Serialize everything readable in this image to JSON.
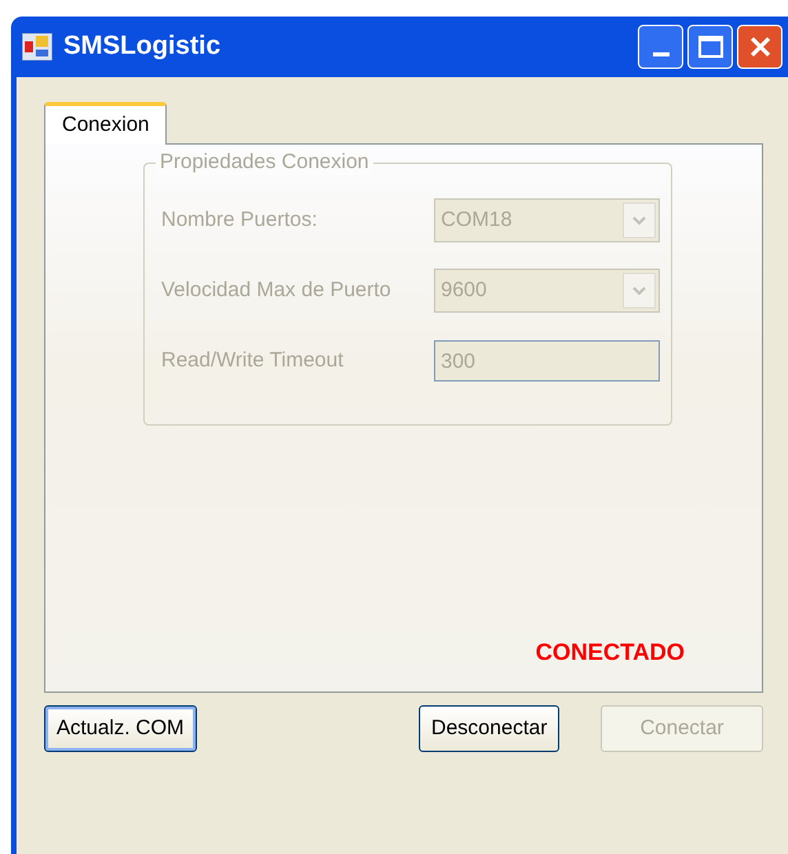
{
  "window": {
    "title": "SMSLogistic"
  },
  "tabs": [
    {
      "label": "Conexion",
      "selected": true
    }
  ],
  "group": {
    "title": "Propiedades Conexion",
    "disabled": true
  },
  "fields": [
    {
      "label": "Nombre Puertos:",
      "kind": "combo",
      "value": "COM18"
    },
    {
      "label": "Velocidad Max de Puerto",
      "kind": "combo",
      "value": "9600"
    },
    {
      "label": "Read/Write Timeout",
      "kind": "text",
      "value": "300"
    }
  ],
  "status": {
    "text": "CONECTADO",
    "color": "#ff0000"
  },
  "buttons": [
    {
      "label": "Actualz. COM",
      "disabled": false,
      "focused": true
    },
    {
      "label": "Desconectar",
      "disabled": false,
      "focused": false
    },
    {
      "label": "Conectar",
      "disabled": true,
      "focused": false
    }
  ]
}
